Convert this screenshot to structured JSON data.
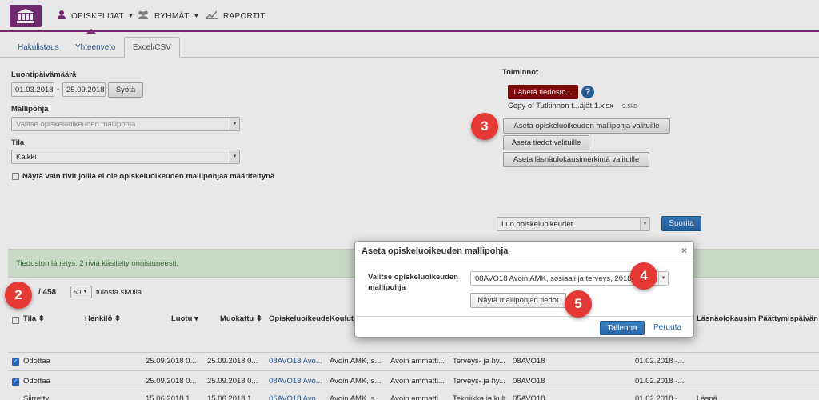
{
  "nav": {
    "items": [
      {
        "label": "OPISKELIJAT",
        "icon": "user-icon",
        "caret": "▼"
      },
      {
        "label": "RYHMÄT",
        "icon": "group-icon",
        "caret": "▼"
      },
      {
        "label": "RAPORTIT",
        "icon": "chart-icon"
      }
    ]
  },
  "tabs": [
    "Hakulistaus",
    "Yhteenveto",
    "Excel/CSV"
  ],
  "filters": {
    "date_label": "Luontipäivämäärä",
    "date_from": "01.03.2018",
    "date_sep": "-",
    "date_to": "25.09.2018",
    "submit_label": "Syötä",
    "template_label": "Mallipohja",
    "template_placeholder": "Valitse opiskeluoikeuden mallipohja",
    "state_label": "Tila",
    "state_value": "Kaikki",
    "only_missing_label": "Näytä vain rivit joilla ei ole opiskeluoikeuden mallipohjaa määriteltynä"
  },
  "actions": {
    "title": "Toiminnot",
    "upload_label": "Lähetä tiedosto...",
    "help_glyph": "?",
    "file_name": "Copy of Tutkinnon t...äjät 1.xlsx",
    "file_size": "9.5kB",
    "set_template_label": "Aseta opiskeluoikeuden mallipohja valituille",
    "set_info_label": "Aseta tiedot valituille",
    "set_presence_label": "Aseta läsnäolokausimerkintä valituille",
    "create_select": "Luo opiskeluoikeudet",
    "run_label": "Suorita"
  },
  "success_message": "Tiedoston lähetys: 2 riviä käsitelty onnistuneesti.",
  "list": {
    "count": "/ 458",
    "page_size": "50",
    "page_size_suffix": "tulosta sivulla",
    "headers": [
      "Tila",
      "Henkilö",
      "Luotu",
      "Muokattu",
      "Opiskeluoikeude",
      "Koulut",
      "Läsnäolokausim",
      "Päättymispäivän"
    ],
    "rows": [
      {
        "tila": "Odottaa",
        "luotu": "25.09.2018 0...",
        "muokattu": "25.09.2018 0...",
        "oo": "08AVO18 Avo...",
        "koulutus": "Avoin AMK, s...",
        "c2": "Avoin ammatti...",
        "c3": "Terveys- ja hy...",
        "c4": "08AVO18",
        "alku": "01.02.2018 -..."
      },
      {
        "tila": "Odottaa",
        "luotu": "25.09.2018 0...",
        "muokattu": "25.09.2018 0...",
        "oo": "08AVO18 Avo...",
        "koulutus": "Avoin AMK, s...",
        "c2": "Avoin ammatti...",
        "c3": "Terveys- ja hy...",
        "c4": "08AVO18",
        "alku": "01.02.2018 -..."
      },
      {
        "tila": "Siirretty",
        "luotu": "15.06.2018 1...",
        "muokattu": "15.06.2018 1...",
        "oo": "05AVO18 Avo...",
        "koulutus": "Avoin AMK, s...",
        "c2": "Avoin ammatti...",
        "c3": "Tekniikka ja kult...",
        "c4": "05AVO18",
        "alku": "01.02.2018 -...",
        "c5": "Läsnä"
      }
    ]
  },
  "modal": {
    "title": "Aseta opiskeluoikeuden mallipohja",
    "close_glyph": "×",
    "field_label": "Valitse opiskeluoikeuden mallipohja",
    "field_value": "08AVO18 Avoin AMK, sosiaali ja terveys, 2018",
    "show_label": "Näytä mallipohjan tiedot",
    "save_label": "Tallenna",
    "cancel_label": "Peruuta"
  },
  "callouts": [
    "2",
    "3",
    "4",
    "5"
  ],
  "colors": {
    "brand": "#7b2d78",
    "primary": "#2a67a8",
    "danger_button": "#8b0a0a",
    "callout": "#e53935",
    "success_bg": "#dfeedb"
  }
}
